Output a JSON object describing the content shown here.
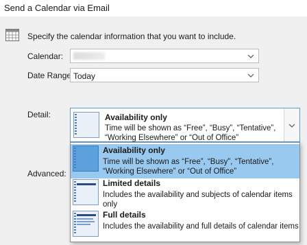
{
  "window": {
    "title": "Send a Calendar via Email"
  },
  "intro": {
    "text": "Specify the calendar information that you want to include."
  },
  "form": {
    "calendar_label": "Calendar:",
    "date_range_label": "Date Range:",
    "date_range_value": "Today",
    "detail_label": "Detail:",
    "advanced_label": "Advanced:"
  },
  "detail_selected": {
    "title": "Availability only",
    "desc_line1": "Time will be shown as “Free”, “Busy”, “Tentative”,",
    "desc_line2": "“Working Elsewhere” or “Out of Office”"
  },
  "detail_options": [
    {
      "title": "Availability only",
      "desc_line1": "Time will be shown as “Free”, “Busy”, “Tentative”,",
      "desc_line2": "“Working Elsewhere” or “Out of Office”",
      "selected": true
    },
    {
      "title": "Limited details",
      "desc_line1": "Includes the availability and subjects of calendar items",
      "desc_line2": "only",
      "selected": false
    },
    {
      "title": "Full details",
      "desc_line1": "Includes the availability and full details of calendar items",
      "desc_line2": "",
      "selected": false
    }
  ],
  "icons": {
    "intro": "calendar-grid-icon",
    "dropdown_arrow": "chevron-down-icon"
  },
  "colors": {
    "selection_highlight": "#99c9ef",
    "focus_border": "#5b9bd5",
    "window_background": "#f0f0f0"
  }
}
